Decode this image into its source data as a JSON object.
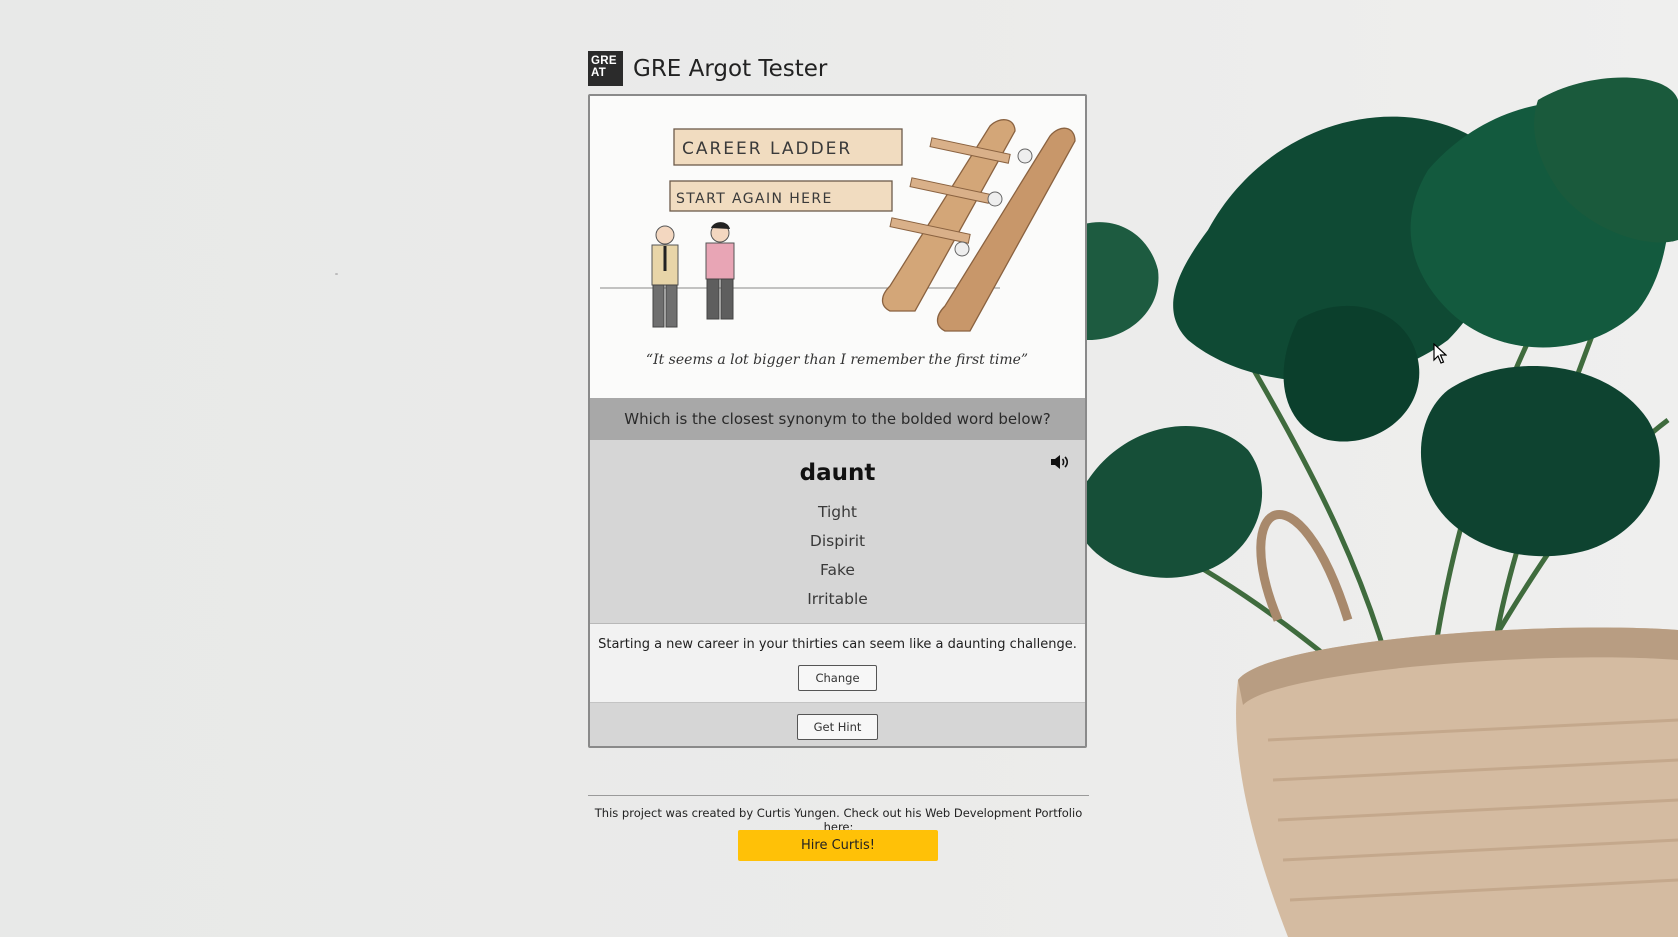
{
  "header": {
    "logo_text_line1": "GRE",
    "logo_text_line2": "AT",
    "title": "GRE Argot Tester"
  },
  "cartoon": {
    "sign_top": "CAREER LADDER",
    "sign_bottom": "START AGAIN HERE",
    "caption": "“It seems a lot bigger than I remember the first time”"
  },
  "quiz": {
    "question": "Which is the closest synonym to the bolded word below?",
    "word": "daunt",
    "options": [
      "Tight",
      "Dispirit",
      "Fake",
      "Irritable"
    ],
    "example_sentence": "Starting a new career in your thirties can seem like a daunting challenge.",
    "change_label": "Change",
    "hint_label": "Get Hint"
  },
  "footer": {
    "text": "This project was created by Curtis Yungen. Check out his Web Development Portfolio here:",
    "hire_label": "Hire Curtis!"
  },
  "colors": {
    "hire_button": "#ffc107",
    "question_bar": "#a8a8a8",
    "word_panel": "#d6d6d6"
  },
  "icons": {
    "speaker": "speaker-icon",
    "plant": "plant-background"
  }
}
